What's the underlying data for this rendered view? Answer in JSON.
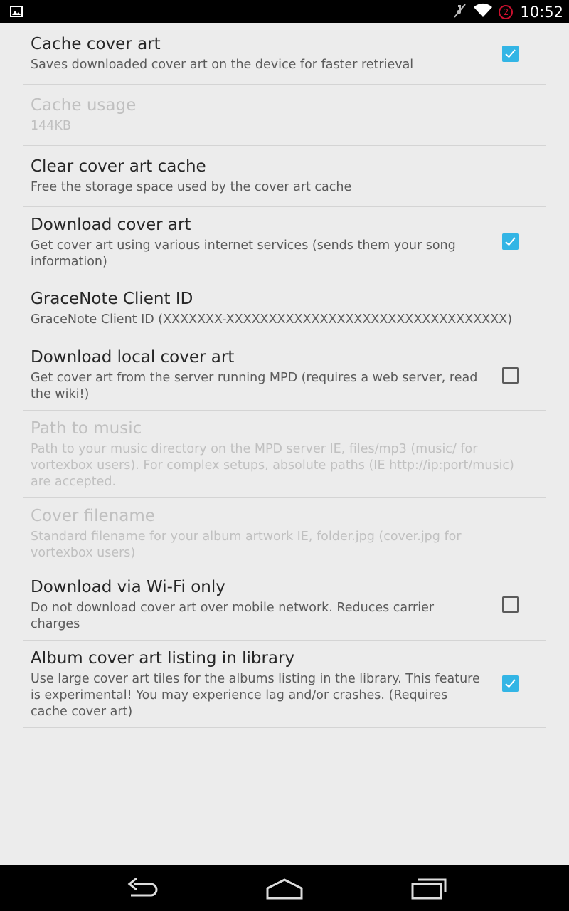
{
  "status_bar": {
    "time": "10:52",
    "notification_count": "2",
    "icons": [
      "image-notification-icon",
      "mute-icon",
      "wifi-icon",
      "notification-badge-icon"
    ]
  },
  "preferences": [
    {
      "title": "Cache cover art",
      "summary": "Saves downloaded cover art on the device for faster retrieval",
      "checkbox": true,
      "checked": true,
      "enabled": true
    },
    {
      "title": "Cache usage",
      "summary": "144KB",
      "checkbox": false,
      "enabled": false
    },
    {
      "title": "Clear cover art cache",
      "summary": "Free the storage space used by the cover art cache",
      "checkbox": false,
      "enabled": true
    },
    {
      "title": "Download cover art",
      "summary": "Get cover art using various internet services (sends them your song information)",
      "checkbox": true,
      "checked": true,
      "enabled": true
    },
    {
      "title": "GraceNote Client ID",
      "summary": "GraceNote Client ID (XXXXXXX-XXXXXXXXXXXXXXXXXXXXXXXXXXXXXXXXX)",
      "checkbox": false,
      "enabled": true
    },
    {
      "title": "Download local cover art",
      "summary": "Get cover art from the server running MPD (requires a web server, read the wiki!)",
      "checkbox": true,
      "checked": false,
      "enabled": true
    },
    {
      "title": "Path to music",
      "summary": "Path to your music directory on the MPD server IE, files/mp3 (music/ for vortexbox users). For complex setups, absolute paths (IE http://ip:port/music) are accepted.",
      "checkbox": false,
      "enabled": false
    },
    {
      "title": "Cover filename",
      "summary": "Standard filename for your album artwork IE, folder.jpg (cover.jpg for vortexbox users)",
      "checkbox": false,
      "enabled": false
    },
    {
      "title": "Download via Wi-Fi only",
      "summary": "Do not download cover art over mobile network. Reduces carrier charges",
      "checkbox": true,
      "checked": false,
      "enabled": true
    },
    {
      "title": "Album cover art listing in library",
      "summary": "Use large cover art tiles for the albums listing in the library. This feature is experimental! You may experience lag and/or crashes. (Requires cache cover art)",
      "checkbox": true,
      "checked": true,
      "enabled": true
    }
  ],
  "navigation": {
    "icons": [
      "back-icon",
      "home-icon",
      "recent-apps-icon"
    ]
  },
  "colors": {
    "accent": "#33b5e5",
    "background": "#ececec",
    "divider": "#d4d4d4",
    "disabled_text": "#c0c0c0"
  }
}
